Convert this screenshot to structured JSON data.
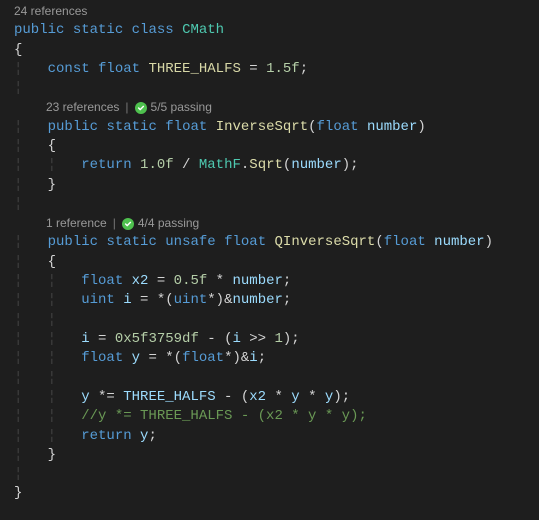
{
  "codelens": {
    "top": "24 references",
    "inverseSqrt": {
      "refs": "23 references",
      "tests": "5/5 passing"
    },
    "qInverseSqrt": {
      "refs": "1 reference",
      "tests": "4/4 passing"
    }
  },
  "code": {
    "l1_public": "public",
    "l1_static": "static",
    "l1_class": "class",
    "l1_name": "CMath",
    "l2_ob": "{",
    "l3_const": "const",
    "l3_float": "float",
    "l3_name": "THREE_HALFS",
    "l3_eq": " = ",
    "l3_val": "1.5f",
    "l3_semi": ";",
    "m1_public": "public",
    "m1_static": "static",
    "m1_ret": "float",
    "m1_name": "InverseSqrt",
    "m1_op": "(",
    "m1_ptype": "float",
    "m1_pname": "number",
    "m1_cp": ")",
    "m1_ob": "{",
    "m1_return": "return",
    "m1_one": "1.0f",
    "m1_div": " / ",
    "m1_mathf": "MathF",
    "m1_dot": ".",
    "m1_sqrt": "Sqrt",
    "m1_op2": "(",
    "m1_arg": "number",
    "m1_cp2": ")",
    "m1_semi": ";",
    "m1_cb": "}",
    "m2_public": "public",
    "m2_static": "static",
    "m2_unsafe": "unsafe",
    "m2_ret": "float",
    "m2_name": "QInverseSqrt",
    "m2_op": "(",
    "m2_ptype": "float",
    "m2_pname": "number",
    "m2_cp": ")",
    "m2_ob": "{",
    "m2_l1_t": "float",
    "m2_l1_v": "x2",
    "m2_l1_eq": " = ",
    "m2_l1_n": "0.5f",
    "m2_l1_mul": " * ",
    "m2_l1_var": "number",
    "m2_l1_s": ";",
    "m2_l2_t": "uint",
    "m2_l2_v": "i",
    "m2_l2_eq": " = *(",
    "m2_l2_cast": "uint",
    "m2_l2_rest": "*)&",
    "m2_l2_var": "number",
    "m2_l2_s": ";",
    "m2_l3_v": "i",
    "m2_l3_eq": " = ",
    "m2_l3_hex": "0x5f3759df",
    "m2_l3_min": " - (",
    "m2_l3_i": "i",
    "m2_l3_sh": " >> ",
    "m2_l3_one": "1",
    "m2_l3_cp": ")",
    "m2_l3_s": ";",
    "m2_l4_t": "float",
    "m2_l4_v": "y",
    "m2_l4_eq": " = *(",
    "m2_l4_cast": "float",
    "m2_l4_rest": "*)&",
    "m2_l4_var": "i",
    "m2_l4_s": ";",
    "m2_l5_v": "y",
    "m2_l5_op": " *= ",
    "m2_l5_c": "THREE_HALFS",
    "m2_l5_min": " - (",
    "m2_l5_x2": "x2",
    "m2_l5_m1": " * ",
    "m2_l5_y1": "y",
    "m2_l5_m2": " * ",
    "m2_l5_y2": "y",
    "m2_l5_cp": ")",
    "m2_l5_s": ";",
    "m2_l6_comment": "//y *= THREE_HALFS - (x2 * y * y);",
    "m2_l7_ret": "return",
    "m2_l7_v": "y",
    "m2_l7_s": ";",
    "m2_cb": "}",
    "close": "}"
  },
  "guides": {
    "g1": "¦   ",
    "g2": "¦   ¦   "
  }
}
